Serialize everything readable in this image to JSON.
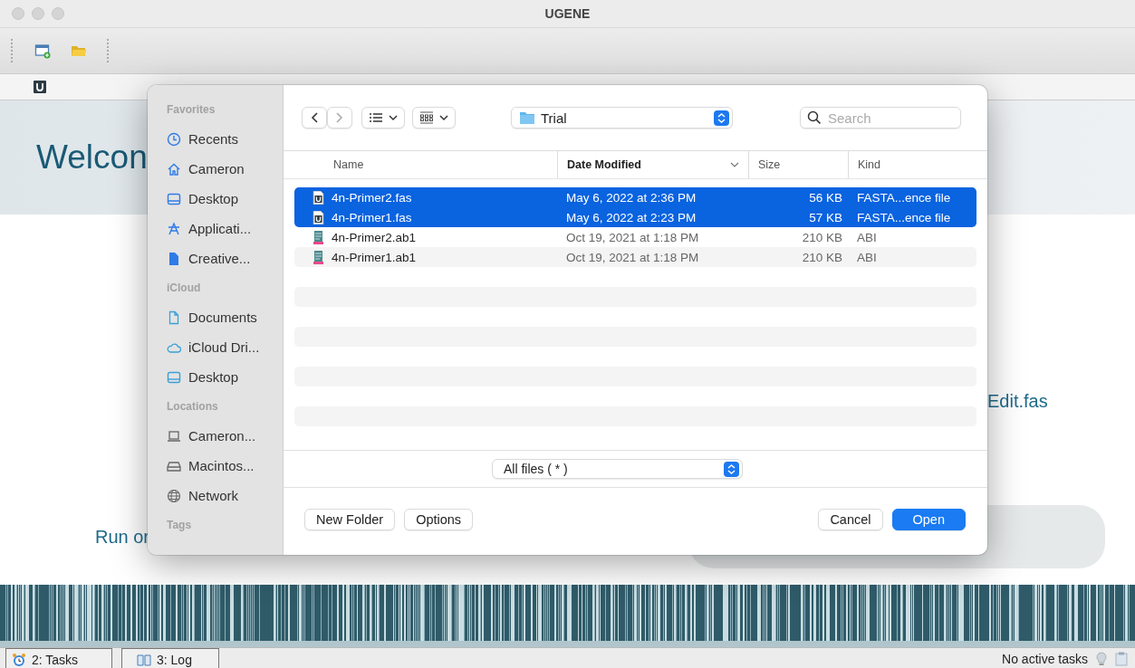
{
  "window": {
    "title": "UGENE"
  },
  "start_page": {
    "heading": "Welcon",
    "texts": [
      {
        "kind": "right",
        "text": "Edit.fas"
      },
      {
        "kind": "bottom",
        "text": "Run or"
      }
    ]
  },
  "file_dialog": {
    "sidebar": [
      {
        "title": "Favorites",
        "items": [
          {
            "label": "Recents",
            "kind": "clock",
            "selected": false
          },
          {
            "label": "Cameron",
            "kind": "home",
            "selected": false
          },
          {
            "label": "Desktop",
            "kind": "desktop",
            "selected": false
          },
          {
            "label": "Applicati...",
            "kind": "apps",
            "selected": false
          },
          {
            "label": "Creative...",
            "kind": "file",
            "selected": false
          }
        ]
      },
      {
        "title": "iCloud",
        "items": [
          {
            "label": "Documents",
            "kind": "doc",
            "selected": false
          },
          {
            "label": "iCloud Dri...",
            "kind": "cloud",
            "selected": false
          },
          {
            "label": "Desktop",
            "kind": "desktop2",
            "selected": false
          }
        ]
      },
      {
        "title": "Locations",
        "items": [
          {
            "label": "Cameron...",
            "kind": "laptop",
            "selected": false
          },
          {
            "label": "Macintos...",
            "kind": "disk",
            "selected": false
          },
          {
            "label": "Network",
            "kind": "globe",
            "selected": false
          }
        ]
      },
      {
        "title": "Tags"
      }
    ],
    "location": "Trial",
    "search": {
      "placeholder": "Search"
    },
    "columns": [
      {
        "label": "Name",
        "sorted": false
      },
      {
        "label": "Date Modified",
        "sorted": true
      },
      {
        "label": "Size",
        "sorted": false
      },
      {
        "label": "Kind",
        "sorted": false
      }
    ],
    "rows": [
      {
        "name": "4n-Primer2.fas",
        "date": "May 6, 2022 at 2:36 PM",
        "size": "56 KB",
        "kind_text": "FASTA...ence file",
        "kind": "fasta",
        "selected": true
      },
      {
        "name": "4n-Primer1.fas",
        "date": "May 6, 2022 at 2:23 PM",
        "size": "57 KB",
        "kind_text": "FASTA...ence file",
        "kind": "fasta",
        "selected": true
      },
      {
        "name": "4n-Primer2.ab1",
        "date": "Oct 19, 2021 at 1:18 PM",
        "size": "210 KB",
        "kind_text": "ABI",
        "kind": "abi",
        "selected": false
      },
      {
        "name": "4n-Primer1.ab1",
        "date": "Oct 19, 2021 at 1:18 PM",
        "size": "210 KB",
        "kind_text": "ABI",
        "kind": "abi",
        "selected": false
      }
    ],
    "filter": "All files ( * )",
    "buttons": [
      {
        "label": "New Folder",
        "kind": "left",
        "default": false
      },
      {
        "label": "Options",
        "kind": "left",
        "default": false
      },
      {
        "label": "Cancel",
        "kind": "right",
        "default": false
      },
      {
        "label": "Open",
        "kind": "right",
        "default": true
      }
    ]
  },
  "status_bar": {
    "tabs": [
      {
        "label": "2: Tasks",
        "kind": "tasks"
      },
      {
        "label": "3: Log",
        "kind": "log"
      }
    ],
    "status": "No active tasks"
  }
}
